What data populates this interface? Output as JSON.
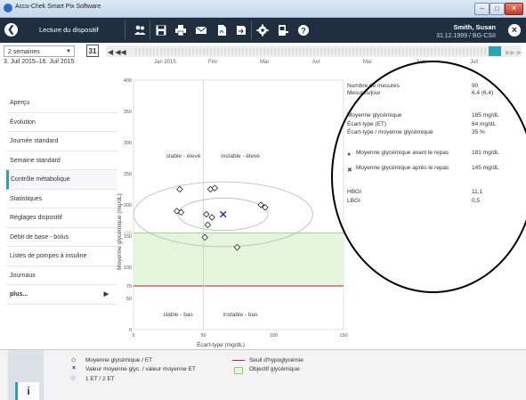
{
  "window": {
    "title": "Accu-Chek Smart Pix Software",
    "minimize": "–",
    "maximize": "□",
    "close": "✕"
  },
  "toolbar": {
    "screen_title": "Lecture du dispositif",
    "patient_name": "Smith, Susan",
    "patient_dob": "31.12.1999 / BG-CSII",
    "icons": [
      "users-icon",
      "save-icon",
      "print-icon",
      "email-icon",
      "pdf-icon",
      "export-icon",
      "settings-icon",
      "device-icon",
      "help-icon"
    ]
  },
  "navigation": {
    "period": "2 semaines",
    "calendar_label": "31",
    "date_range": "3. Juil 2015–16. Juil 2015",
    "months": [
      "Jan 2015",
      "Fév",
      "Mar",
      "Avr",
      "Mai",
      "Juin",
      "Juil"
    ]
  },
  "sidebar": {
    "items": [
      {
        "label": "Aperçu"
      },
      {
        "label": "Évolution"
      },
      {
        "label": "Journée standard"
      },
      {
        "label": "Semaine standard"
      },
      {
        "label": "Contrôle métabolique"
      },
      {
        "label": "Statistiques"
      },
      {
        "label": "Réglages dispositif"
      },
      {
        "label": "Débit de base - bolus"
      },
      {
        "label": "Listes de pompes à insuline"
      },
      {
        "label": "Journaux"
      },
      {
        "label": "plus..."
      }
    ],
    "active_index": 4
  },
  "chart_data": {
    "type": "scatter",
    "xlabel": "Écart-type (mg/dL)",
    "ylabel": "Moyenne glycémique (mg/dL)",
    "xlim": [
      0,
      150
    ],
    "ylim": [
      0,
      400
    ],
    "x_ticks": [
      0,
      50,
      100,
      150
    ],
    "y_ticks": [
      0,
      50,
      100,
      150,
      200,
      250,
      300,
      350,
      400
    ],
    "hypo_threshold": 70,
    "target_range": [
      70,
      155
    ],
    "x_divider": 50,
    "y_divider": 155,
    "quadrant_labels": {
      "top_left": "stable - élevé",
      "top_right": "instable - élevé",
      "bottom_left": "stable - bas",
      "bottom_right": "instable - bas"
    },
    "points": [
      {
        "x": 33,
        "y": 225
      },
      {
        "x": 31,
        "y": 190
      },
      {
        "x": 34,
        "y": 188
      },
      {
        "x": 55,
        "y": 225
      },
      {
        "x": 58,
        "y": 227
      },
      {
        "x": 52,
        "y": 185
      },
      {
        "x": 56,
        "y": 180
      },
      {
        "x": 53,
        "y": 168
      },
      {
        "x": 51,
        "y": 148
      },
      {
        "x": 91,
        "y": 200
      },
      {
        "x": 94,
        "y": 196
      },
      {
        "x": 74,
        "y": 132
      }
    ],
    "mean": {
      "x": 64,
      "y": 185
    },
    "ellipses": [
      {
        "cx": 64,
        "cy": 185,
        "rx": 32,
        "ry": 26
      },
      {
        "cx": 64,
        "cy": 185,
        "rx": 64,
        "ry": 52
      }
    ],
    "colors": {
      "target_fill": "#e4f5dc",
      "target_line": "#8ecb6b",
      "hypo_line": "#b0243a",
      "mean_marker": "#1a2ac8",
      "sd_ellipse": "#b8b8b8"
    }
  },
  "stats": {
    "rows": [
      {
        "label": "Nombre de mesures",
        "value": "90"
      },
      {
        "label": "Mesures/jour",
        "value": "6,4 (6,4)"
      },
      {
        "label": "Moyenne glycémique",
        "value": "185 mg/dL"
      },
      {
        "label": "Écart-type (ET)",
        "value": "64 mg/dL"
      },
      {
        "label": "Écart-type / moyenne glycémique",
        "value": "35 %"
      },
      {
        "label": "Moyenne glycémique avant le repas",
        "value": "181 mg/dL"
      },
      {
        "label": "Moyenne glycémique après le repas",
        "value": "145 mg/dL"
      },
      {
        "label": "HBGI",
        "value": "11,1"
      },
      {
        "label": "LBGI",
        "value": "0,5"
      }
    ]
  },
  "legend": {
    "mean_sd": "Moyenne glycémique / ET",
    "mean_value": "Valeur moyenne glyc. / valeur moyenne ET",
    "ellipses": "1 ET / 2 ET",
    "hypo": "Seuil d'hypoglycémie",
    "target": "Objectif glycémique",
    "info": "i"
  }
}
